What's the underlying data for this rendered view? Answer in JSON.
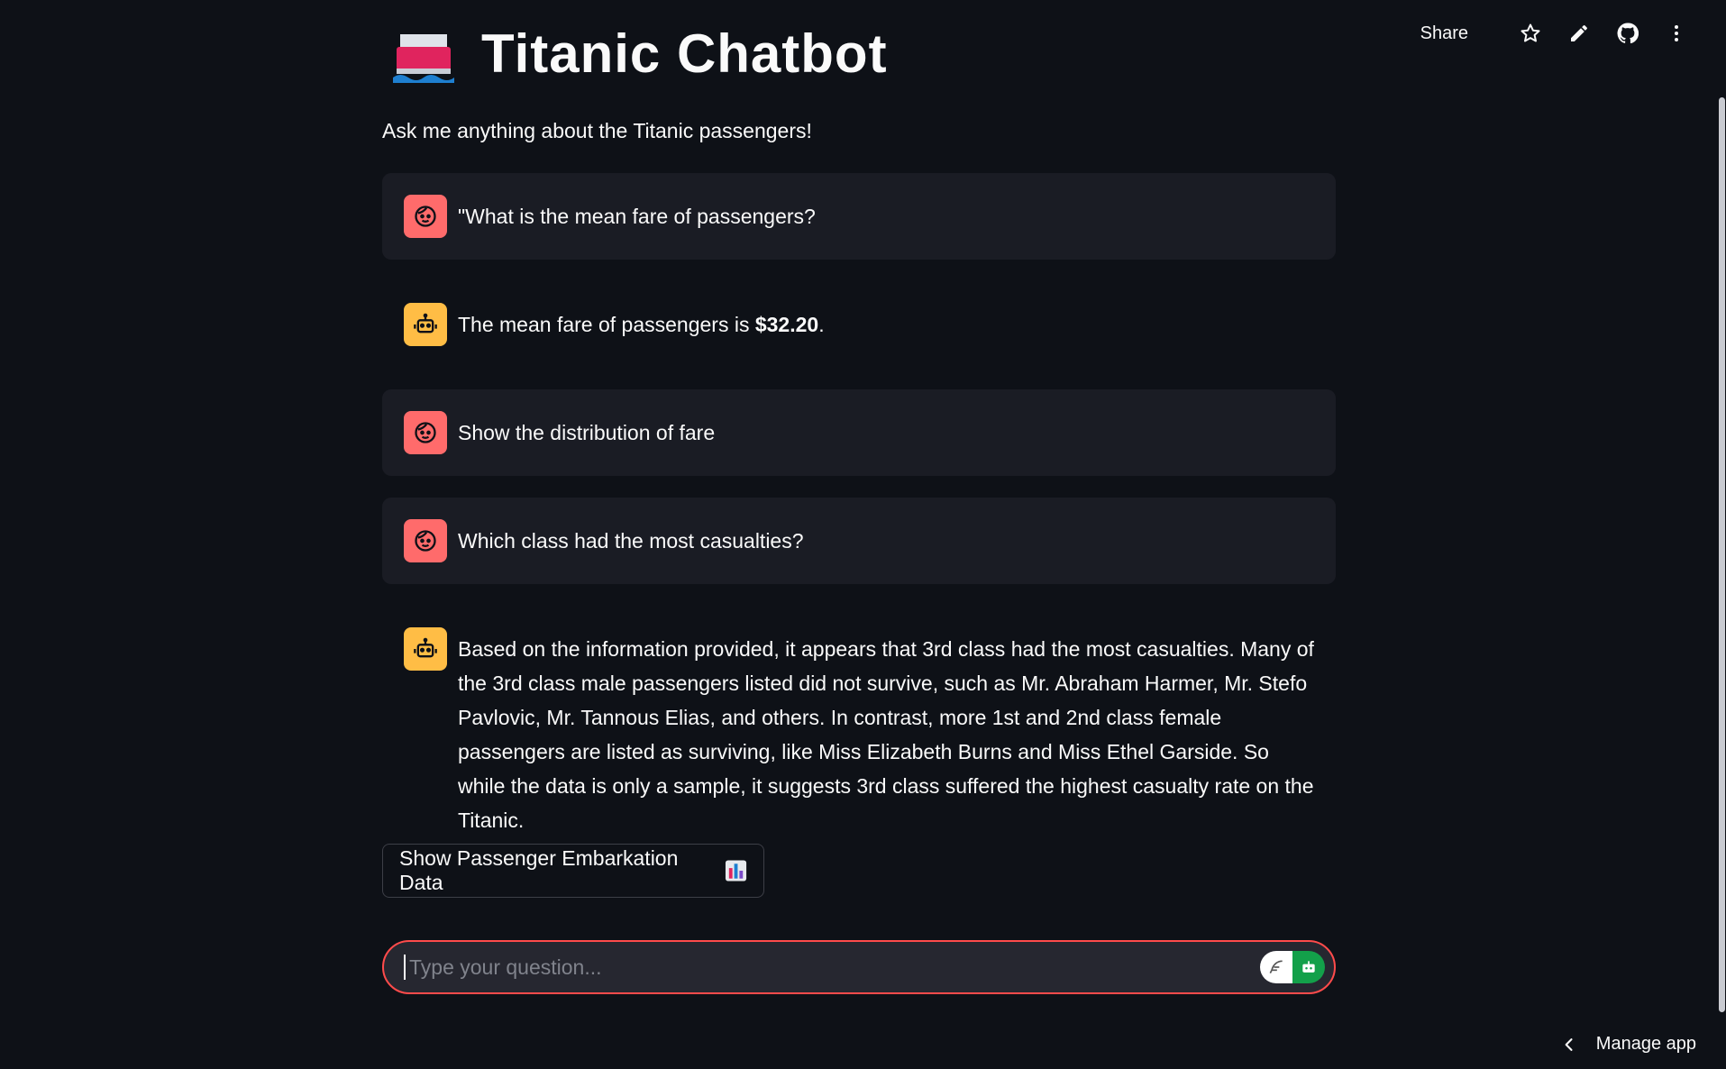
{
  "toolbar": {
    "share_label": "Share",
    "icons": [
      "star-icon",
      "pencil-icon",
      "github-icon",
      "more-vertical-icon"
    ]
  },
  "header": {
    "title": "Titanic Chatbot",
    "subtitle": "Ask me anything about the Titanic passengers!"
  },
  "messages": [
    {
      "role": "user",
      "text": "\"What is the mean fare of passengers?"
    },
    {
      "role": "assistant",
      "text_prefix": "The mean fare of passengers is ",
      "text_bold": "$32.20",
      "text_suffix": "."
    },
    {
      "role": "user",
      "text": "Show the distribution of fare"
    },
    {
      "role": "user",
      "text": "Which class had the most casualties?"
    },
    {
      "role": "assistant",
      "text": "Based on the information provided, it appears that 3rd class had the most casualties. Many of the 3rd class male passengers listed did not survive, such as Mr. Abraham Harmer, Mr. Stefo Pavlovic, Mr. Tannous Elias, and others. In contrast, more 1st and 2nd class female passengers are listed as surviving, like Miss Elizabeth Burns and Miss Ethel Garside. So while the data is only a sample, it suggests 3rd class suffered the highest casualty rate on the Titanic."
    }
  ],
  "action_button": {
    "label": "Show Passenger Embarkation Data",
    "icon": "bar-chart-icon"
  },
  "chat_input": {
    "placeholder": "Type your question...",
    "value": ""
  },
  "footer": {
    "manage_label": "Manage app"
  },
  "colors": {
    "background": "#0e1117",
    "user_avatar": "#ff6b6b",
    "bot_avatar": "#ffbd45",
    "input_border": "#ff4b4b"
  }
}
